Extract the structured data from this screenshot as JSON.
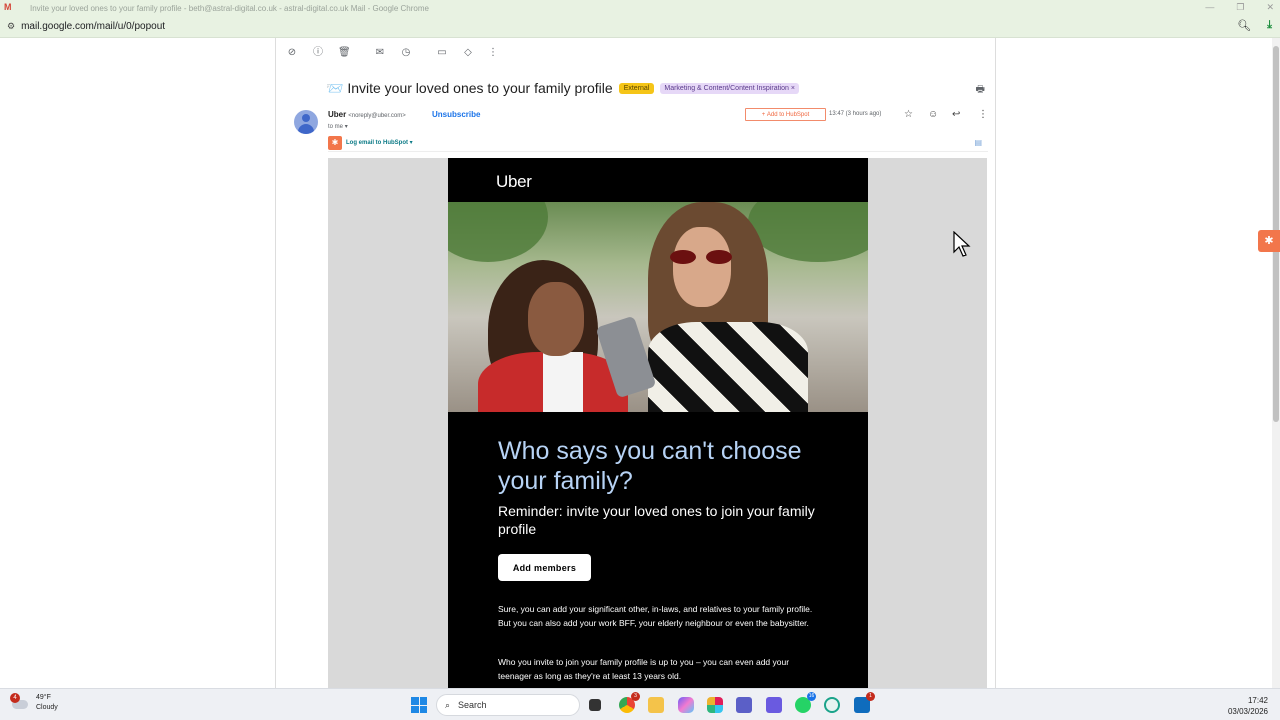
{
  "browser": {
    "window_title": "Invite your loved ones to your family profile - beth@astral-digital.co.uk - astral-digital.co.uk Mail - Google Chrome",
    "url": "mail.google.com/mail/u/0/popout"
  },
  "email": {
    "subject": "Invite your loved ones to your family profile",
    "subject_emoji": "📨",
    "tag_external": "External",
    "tag_label": "Marketing & Content/Content Inspiration",
    "sender_name": "Uber",
    "sender_email": "<noreply@uber.com>",
    "unsubscribe": "Unsubscribe",
    "to_me": "to me",
    "add_to_hubspot": "Add to HubSpot",
    "time": "13:47 (3 hours ago)",
    "hubspot_log": "Log email to HubSpot",
    "body": {
      "logo": "Uber",
      "headline": "Who says you can't choose your family?",
      "subhead": "Reminder: invite your loved ones to join your family profile",
      "cta": "Add members",
      "para1": "Sure, you can add your significant other, in-laws, and relatives to your family profile. But you can also add your work BFF, your elderly neighbour or even the babysitter.",
      "para2": "Who you invite to join your family profile is up to you – you can even add your teenager as long as they're at least 13 years old."
    }
  },
  "taskbar": {
    "weather_badge": "4",
    "temperature": "49°F",
    "condition": "Cloudy",
    "search_placeholder": "Search",
    "time": "17:42",
    "date": "03/03/2026",
    "chrome_badge": "3",
    "whatsapp_badge": "16",
    "outlook_badge": "1"
  },
  "colors": {
    "headline": "#b7d3f5",
    "hubspot": "#f2764b",
    "link": "#1a73e8"
  }
}
